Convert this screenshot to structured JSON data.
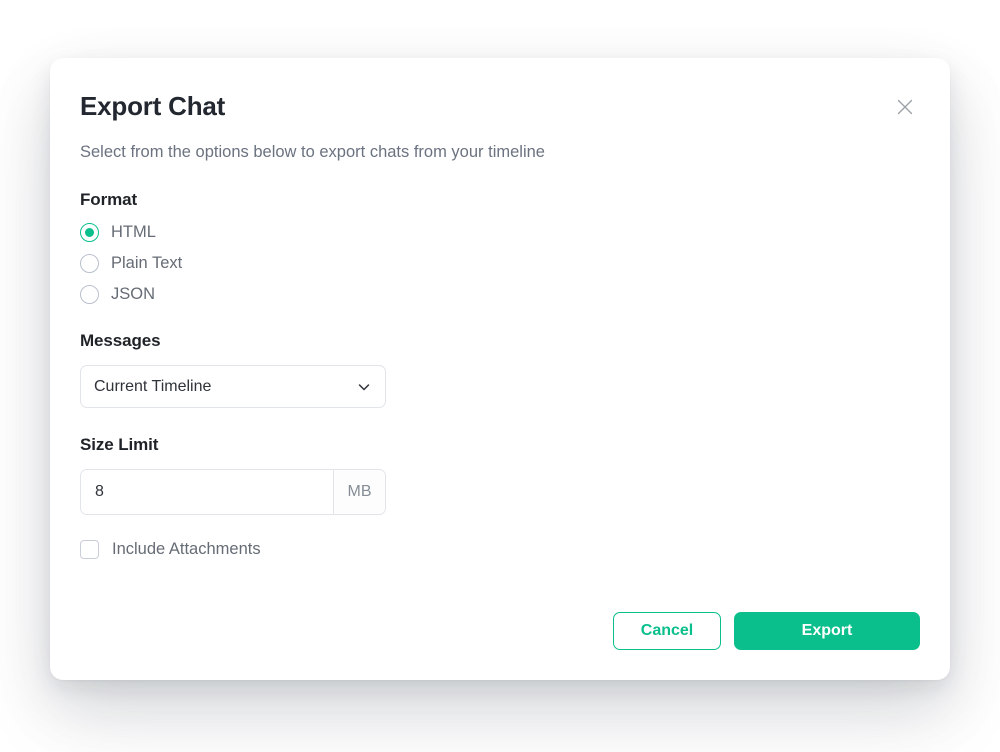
{
  "dialog": {
    "title": "Export Chat",
    "subtitle": "Select from the options below to export chats from your timeline",
    "close_icon": "close-icon"
  },
  "format": {
    "label": "Format",
    "selected": "HTML",
    "options": [
      {
        "label": "HTML",
        "checked": true
      },
      {
        "label": "Plain Text",
        "checked": false
      },
      {
        "label": "JSON",
        "checked": false
      }
    ]
  },
  "messages": {
    "label": "Messages",
    "selected": "Current Timeline",
    "options": [
      "Current Timeline"
    ],
    "chevron_icon": "chevron-down-icon"
  },
  "size_limit": {
    "label": "Size Limit",
    "value": "8",
    "placeholder": "8",
    "unit": "MB"
  },
  "attachments": {
    "label": "Include Attachments",
    "checked": false
  },
  "footer": {
    "cancel_label": "Cancel",
    "export_label": "Export"
  },
  "colors": {
    "accent": "#0bbf8c",
    "title": "#23272f",
    "muted": "#6b7280",
    "border": "#e1e4e8"
  }
}
